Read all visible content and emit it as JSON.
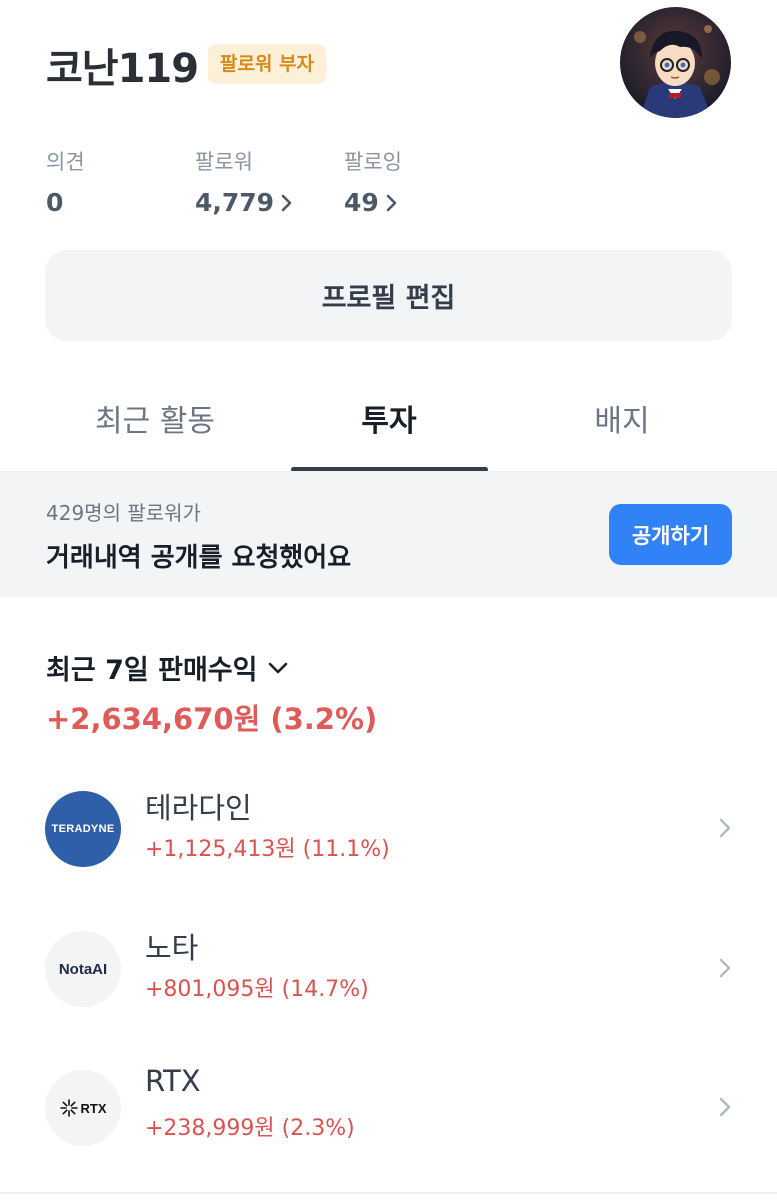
{
  "profile": {
    "name": "코난119",
    "badge": "팔로워 부자"
  },
  "stats": [
    {
      "label": "의견",
      "value": "0"
    },
    {
      "label": "팔로워",
      "value": "4,779"
    },
    {
      "label": "팔로잉",
      "value": "49"
    }
  ],
  "edit_button": "프로필 편집",
  "tabs": [
    {
      "label": "최근 활동",
      "active": false
    },
    {
      "label": "투자",
      "active": true
    },
    {
      "label": "배지",
      "active": false
    }
  ],
  "banner": {
    "subtitle": "429명의 팔로워가",
    "title": "거래내역 공개를 요청했어요",
    "button": "공개하기"
  },
  "sales": {
    "title": "최근 7일 판매수익",
    "amount": "+2,634,670원 (3.2%)"
  },
  "stocks": [
    {
      "name": "테라다인",
      "change": "+1,125,413원 (11.1%)",
      "logo_text": "TERADYNE",
      "logo_bg": "#2f5fa8"
    },
    {
      "name": "노타",
      "change": "+801,095원 (14.7%)",
      "logo_text": "NotaAI",
      "logo_bg": "#f2f4f6"
    },
    {
      "name": "RTX",
      "change": "+238,999원 (2.3%)",
      "logo_text": "RTX",
      "logo_bg": "#f2f4f6"
    }
  ],
  "colors": {
    "accent_blue": "#3182f6",
    "profit_red": "#e05a5a",
    "badge_bg": "#fdf0d9",
    "badge_text": "#d68a1d"
  }
}
